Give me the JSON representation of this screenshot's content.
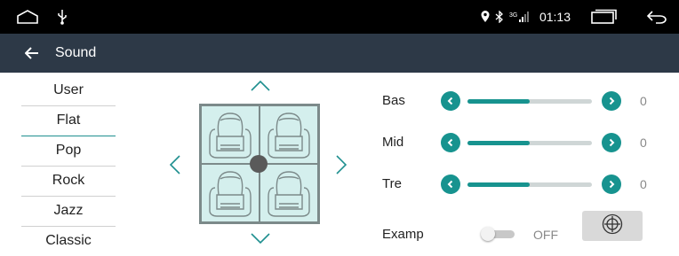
{
  "status_bar": {
    "time": "01:13",
    "network_type": "3G",
    "icons": [
      "home-icon",
      "usb-icon",
      "location-icon",
      "bluetooth-icon",
      "signal-icon",
      "recents-icon",
      "back-icon"
    ]
  },
  "header": {
    "title": "Sound",
    "back_icon": "arrow-left-icon"
  },
  "eq_presets": {
    "items": [
      "User",
      "Flat",
      "Pop",
      "Rock",
      "Jazz",
      "Classic"
    ],
    "selected": "Flat"
  },
  "fader": {
    "icons": [
      "chevron-up-icon",
      "chevron-down-icon",
      "chevron-left-icon",
      "chevron-right-icon"
    ],
    "balance_position": "center"
  },
  "tone": {
    "controls": [
      {
        "label": "Bas",
        "value": "0",
        "level": 0.5
      },
      {
        "label": "Mid",
        "value": "0",
        "level": 0.5
      },
      {
        "label": "Tre",
        "value": "0",
        "level": 0.5
      }
    ]
  },
  "examp": {
    "label": "Examp",
    "state": "OFF",
    "button_icon": "target-icon"
  },
  "colors": {
    "accent": "#17938f",
    "title_bar": "#2d3947",
    "status_bar": "#000000",
    "seat_fill": "#d4efed"
  }
}
